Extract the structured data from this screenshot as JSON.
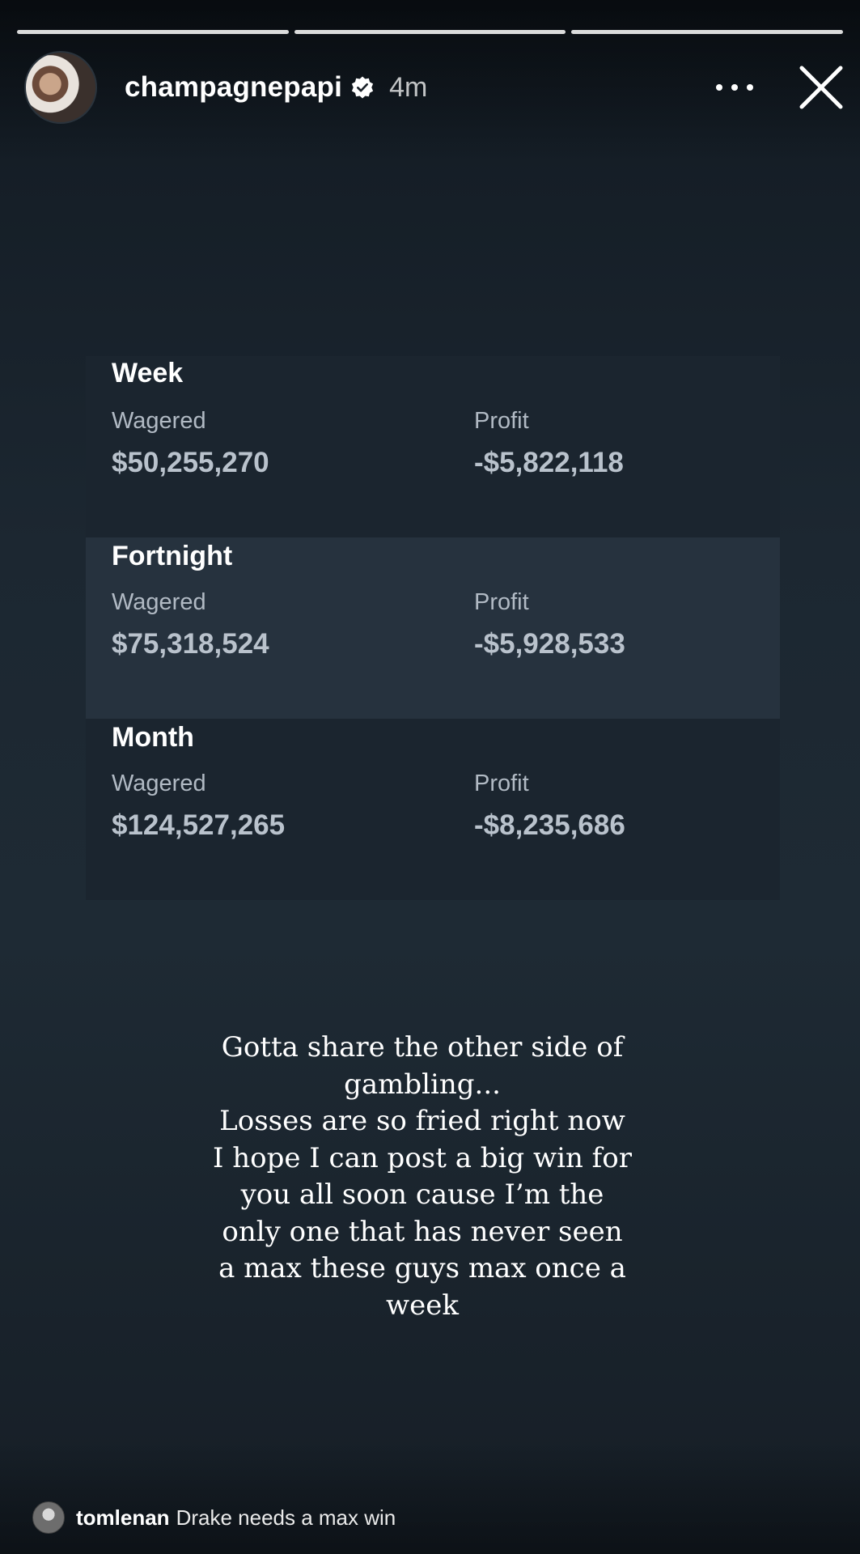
{
  "story": {
    "progress_segments": 3,
    "header": {
      "username": "champagnepapi",
      "verified_icon": "verified-badge-icon",
      "time_ago": "4m",
      "more_icon": "more-horizontal-icon",
      "close_icon": "close-icon"
    },
    "stats": [
      {
        "period": "Week",
        "wagered_label": "Wagered",
        "wagered_value": "$50,255,270",
        "profit_label": "Profit",
        "profit_value": "-$5,822,118"
      },
      {
        "period": "Fortnight",
        "wagered_label": "Wagered",
        "wagered_value": "$75,318,524",
        "profit_label": "Profit",
        "profit_value": "-$5,928,533"
      },
      {
        "period": "Month",
        "wagered_label": "Wagered",
        "wagered_value": "$124,527,265",
        "profit_label": "Profit",
        "profit_value": "-$8,235,686"
      }
    ],
    "caption": "Gotta share the other side of\ngambling...\nLosses are so fried right now\nI hope I can post a big win for\nyou all soon cause I’m the\nonly one that has never seen\na max these guys max once a\nweek",
    "reply": {
      "username": "tomlenan",
      "text": "Drake needs a max win"
    }
  },
  "colors": {
    "background": "#1e2a34",
    "panel": "#1b252f",
    "panel_highlight": "#26323e",
    "label": "#b1bac4",
    "value": "#b9c2cc"
  }
}
